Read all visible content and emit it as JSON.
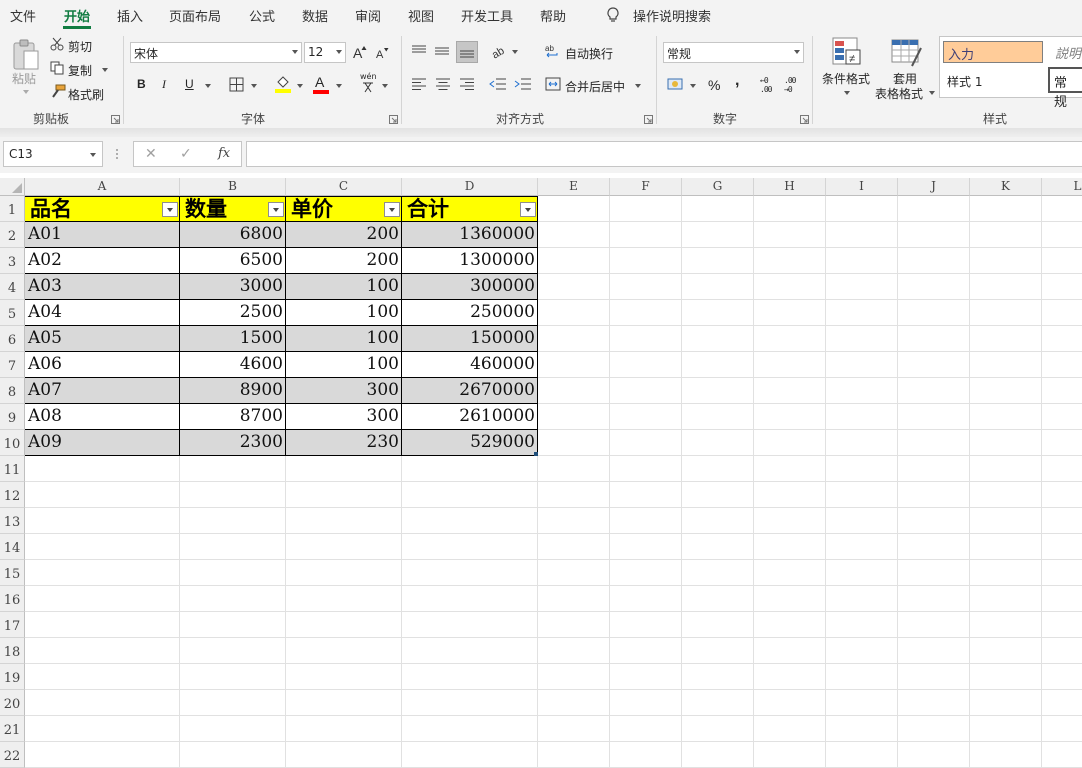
{
  "menu": {
    "tabs": [
      "文件",
      "开始",
      "插入",
      "页面布局",
      "公式",
      "数据",
      "审阅",
      "视图",
      "开发工具",
      "帮助"
    ],
    "active_tab": "开始",
    "tell_me": "操作说明搜索"
  },
  "ribbon": {
    "clipboard": {
      "paste": "粘贴",
      "cut": "剪切",
      "copy": "复制",
      "format_painter": "格式刷",
      "label": "剪贴板"
    },
    "font": {
      "name": "宋体",
      "size": "12",
      "bold": "B",
      "italic": "I",
      "underline": "U",
      "font_color_glyph": "A",
      "phonetic_glyph": "wén",
      "label": "字体"
    },
    "alignment": {
      "wrap_text": "自动换行",
      "merge_center": "合并后居中",
      "label": "对齐方式"
    },
    "number": {
      "format": "常规",
      "percent": "%",
      "comma": ",",
      "increase_decimal": "←0 .00",
      "decrease_decimal": ".00 →0",
      "label": "数字"
    },
    "styles": {
      "conditional_format": "条件格式",
      "format_as_table_line1": "套用",
      "format_as_table_line2": "表格格式",
      "style_input": "入力",
      "style_explain": "説明",
      "style_1": "样式 1",
      "style_normal": "常规",
      "label": "样式"
    },
    "colors": {
      "highlight": "#ffff00",
      "font_color": "#ff0000",
      "style_input_bg": "#ffcc99",
      "accent": "#107c41"
    }
  },
  "formula_bar": {
    "name_box": "C13",
    "cancel": "✕",
    "enter": "✓",
    "fx": "fx",
    "formula": ""
  },
  "sheet": {
    "columns": [
      "A",
      "B",
      "C",
      "D",
      "E",
      "F",
      "G",
      "H",
      "I",
      "J",
      "K",
      "L"
    ],
    "rows": [
      "1",
      "2",
      "3",
      "4",
      "5",
      "6",
      "7",
      "8",
      "9",
      "10",
      "11",
      "12",
      "13",
      "14",
      "15",
      "16",
      "17",
      "18",
      "19",
      "20",
      "21",
      "22"
    ],
    "table": {
      "headers": [
        "品名",
        "数量",
        "单价",
        "合计"
      ],
      "rows": [
        [
          "A01",
          "6800",
          "200",
          "1360000"
        ],
        [
          "A02",
          "6500",
          "200",
          "1300000"
        ],
        [
          "A03",
          "3000",
          "100",
          "300000"
        ],
        [
          "A04",
          "2500",
          "100",
          "250000"
        ],
        [
          "A05",
          "1500",
          "100",
          "150000"
        ],
        [
          "A06",
          "4600",
          "100",
          "460000"
        ],
        [
          "A07",
          "8900",
          "300",
          "2670000"
        ],
        [
          "A08",
          "8700",
          "300",
          "2610000"
        ],
        [
          "A09",
          "2300",
          "230",
          "529000"
        ]
      ],
      "header_fill": "#ffff00",
      "band_fill": "#d9d9d9"
    }
  }
}
